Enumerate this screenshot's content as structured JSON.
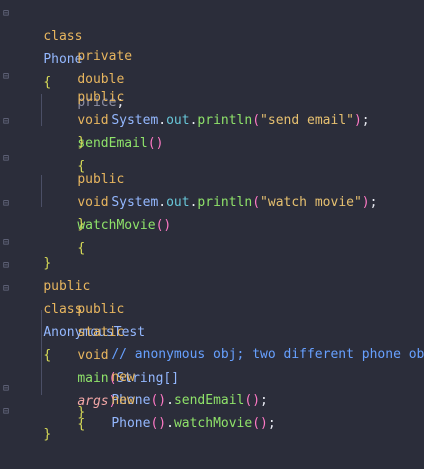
{
  "code": {
    "line1": {
      "kw1": "class",
      "name": "Phone",
      "brace": "{"
    },
    "line2": {
      "kw1": "private",
      "kw2": "double",
      "field": "price",
      "semi": ";"
    },
    "line4": {
      "kw1": "public",
      "kw2": "void",
      "method": "sendEmail",
      "paren": "()",
      "brace": "{"
    },
    "line5": {
      "obj": "System",
      "dot1": ".",
      "field": "out",
      "dot2": ".",
      "call": "println",
      "lp": "(",
      "str": "\"send email\"",
      "rp": ")",
      "semi": ";"
    },
    "line6": {
      "brace": "}"
    },
    "line8": {
      "kw1": "public",
      "kw2": "void",
      "method": "watchMovie",
      "paren": "()",
      "brace": "{"
    },
    "line9": {
      "obj": "System",
      "dot1": ".",
      "field": "out",
      "dot2": ".",
      "call": "println",
      "lp": "(",
      "str": "\"watch movie\"",
      "rp": ")",
      "semi": ";"
    },
    "line10": {
      "brace": "}"
    },
    "line12": {
      "brace": "}"
    },
    "line13": {
      "kw1": "public",
      "kw2": "class",
      "name": "AnonymousTest",
      "brace": "{"
    },
    "line14": {
      "kw1": "public",
      "kw2": "static",
      "kw3": "void",
      "method": "main",
      "lp": "(",
      "type": "String[]",
      "param": "args",
      "rp": ")",
      "brace": "{"
    },
    "line16": {
      "comment": "// anonymous obj; two different phone objs"
    },
    "line17": {
      "kw": "new",
      "cls": "Phone",
      "paren": "()",
      "dot": ".",
      "method": "sendEmail",
      "paren2": "()",
      "semi": ";"
    },
    "line18": {
      "kw": "new",
      "cls": "Phone",
      "paren": "()",
      "dot": ".",
      "method": "watchMovie",
      "paren2": "()",
      "semi": ";"
    },
    "line19": {
      "brace": "}"
    },
    "line20": {
      "brace": "}"
    }
  },
  "colors": {
    "background": "#2b2d3a",
    "keyword": "#e8b65f",
    "class": "#94b8ff",
    "method": "#8fe36a",
    "field": "#68c7d9",
    "string": "#e6c070",
    "comment": "#67a0ff",
    "param": "#f3a7a7"
  },
  "icons": {
    "fold": "fold-icon"
  }
}
